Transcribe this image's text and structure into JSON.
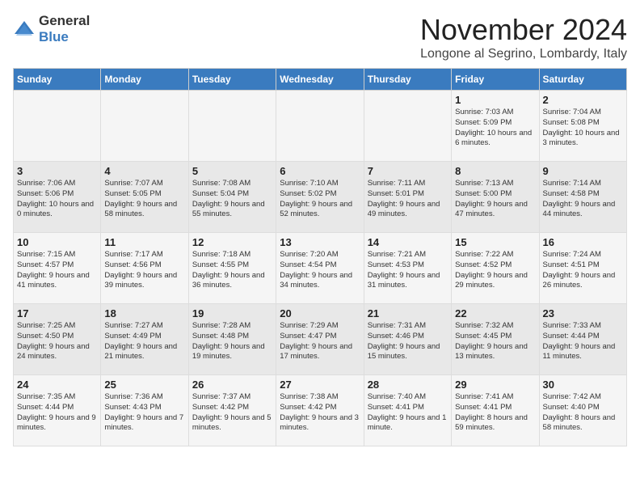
{
  "logo": {
    "text_general": "General",
    "text_blue": "Blue"
  },
  "header": {
    "month_title": "November 2024",
    "location": "Longone al Segrino, Lombardy, Italy"
  },
  "days_of_week": [
    "Sunday",
    "Monday",
    "Tuesday",
    "Wednesday",
    "Thursday",
    "Friday",
    "Saturday"
  ],
  "weeks": [
    [
      {
        "day": "",
        "content": ""
      },
      {
        "day": "",
        "content": ""
      },
      {
        "day": "",
        "content": ""
      },
      {
        "day": "",
        "content": ""
      },
      {
        "day": "",
        "content": ""
      },
      {
        "day": "1",
        "content": "Sunrise: 7:03 AM\nSunset: 5:09 PM\nDaylight: 10 hours and 6 minutes."
      },
      {
        "day": "2",
        "content": "Sunrise: 7:04 AM\nSunset: 5:08 PM\nDaylight: 10 hours and 3 minutes."
      }
    ],
    [
      {
        "day": "3",
        "content": "Sunrise: 7:06 AM\nSunset: 5:06 PM\nDaylight: 10 hours and 0 minutes."
      },
      {
        "day": "4",
        "content": "Sunrise: 7:07 AM\nSunset: 5:05 PM\nDaylight: 9 hours and 58 minutes."
      },
      {
        "day": "5",
        "content": "Sunrise: 7:08 AM\nSunset: 5:04 PM\nDaylight: 9 hours and 55 minutes."
      },
      {
        "day": "6",
        "content": "Sunrise: 7:10 AM\nSunset: 5:02 PM\nDaylight: 9 hours and 52 minutes."
      },
      {
        "day": "7",
        "content": "Sunrise: 7:11 AM\nSunset: 5:01 PM\nDaylight: 9 hours and 49 minutes."
      },
      {
        "day": "8",
        "content": "Sunrise: 7:13 AM\nSunset: 5:00 PM\nDaylight: 9 hours and 47 minutes."
      },
      {
        "day": "9",
        "content": "Sunrise: 7:14 AM\nSunset: 4:58 PM\nDaylight: 9 hours and 44 minutes."
      }
    ],
    [
      {
        "day": "10",
        "content": "Sunrise: 7:15 AM\nSunset: 4:57 PM\nDaylight: 9 hours and 41 minutes."
      },
      {
        "day": "11",
        "content": "Sunrise: 7:17 AM\nSunset: 4:56 PM\nDaylight: 9 hours and 39 minutes."
      },
      {
        "day": "12",
        "content": "Sunrise: 7:18 AM\nSunset: 4:55 PM\nDaylight: 9 hours and 36 minutes."
      },
      {
        "day": "13",
        "content": "Sunrise: 7:20 AM\nSunset: 4:54 PM\nDaylight: 9 hours and 34 minutes."
      },
      {
        "day": "14",
        "content": "Sunrise: 7:21 AM\nSunset: 4:53 PM\nDaylight: 9 hours and 31 minutes."
      },
      {
        "day": "15",
        "content": "Sunrise: 7:22 AM\nSunset: 4:52 PM\nDaylight: 9 hours and 29 minutes."
      },
      {
        "day": "16",
        "content": "Sunrise: 7:24 AM\nSunset: 4:51 PM\nDaylight: 9 hours and 26 minutes."
      }
    ],
    [
      {
        "day": "17",
        "content": "Sunrise: 7:25 AM\nSunset: 4:50 PM\nDaylight: 9 hours and 24 minutes."
      },
      {
        "day": "18",
        "content": "Sunrise: 7:27 AM\nSunset: 4:49 PM\nDaylight: 9 hours and 21 minutes."
      },
      {
        "day": "19",
        "content": "Sunrise: 7:28 AM\nSunset: 4:48 PM\nDaylight: 9 hours and 19 minutes."
      },
      {
        "day": "20",
        "content": "Sunrise: 7:29 AM\nSunset: 4:47 PM\nDaylight: 9 hours and 17 minutes."
      },
      {
        "day": "21",
        "content": "Sunrise: 7:31 AM\nSunset: 4:46 PM\nDaylight: 9 hours and 15 minutes."
      },
      {
        "day": "22",
        "content": "Sunrise: 7:32 AM\nSunset: 4:45 PM\nDaylight: 9 hours and 13 minutes."
      },
      {
        "day": "23",
        "content": "Sunrise: 7:33 AM\nSunset: 4:44 PM\nDaylight: 9 hours and 11 minutes."
      }
    ],
    [
      {
        "day": "24",
        "content": "Sunrise: 7:35 AM\nSunset: 4:44 PM\nDaylight: 9 hours and 9 minutes."
      },
      {
        "day": "25",
        "content": "Sunrise: 7:36 AM\nSunset: 4:43 PM\nDaylight: 9 hours and 7 minutes."
      },
      {
        "day": "26",
        "content": "Sunrise: 7:37 AM\nSunset: 4:42 PM\nDaylight: 9 hours and 5 minutes."
      },
      {
        "day": "27",
        "content": "Sunrise: 7:38 AM\nSunset: 4:42 PM\nDaylight: 9 hours and 3 minutes."
      },
      {
        "day": "28",
        "content": "Sunrise: 7:40 AM\nSunset: 4:41 PM\nDaylight: 9 hours and 1 minute."
      },
      {
        "day": "29",
        "content": "Sunrise: 7:41 AM\nSunset: 4:41 PM\nDaylight: 8 hours and 59 minutes."
      },
      {
        "day": "30",
        "content": "Sunrise: 7:42 AM\nSunset: 4:40 PM\nDaylight: 8 hours and 58 minutes."
      }
    ]
  ]
}
